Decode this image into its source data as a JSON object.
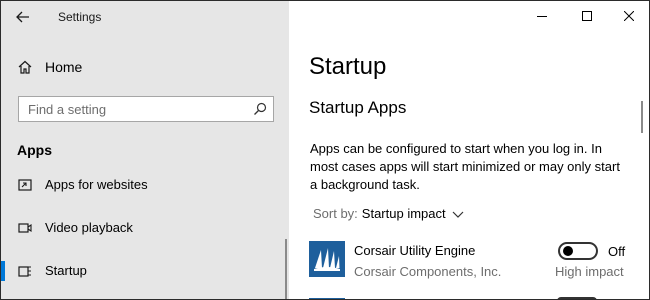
{
  "window": {
    "title": "Settings",
    "controls": {
      "minimize": "minimize-icon",
      "maximize": "maximize-icon",
      "close": "close-icon"
    }
  },
  "sidebar": {
    "home_label": "Home",
    "search_placeholder": "Find a setting",
    "section_header": "Apps",
    "items": [
      {
        "label": "Apps for websites",
        "icon": "open-in-window-icon"
      },
      {
        "label": "Video playback",
        "icon": "video-icon"
      },
      {
        "label": "Startup",
        "icon": "startup-icon",
        "selected": true
      }
    ]
  },
  "main": {
    "page_title": "Startup",
    "section_title": "Startup Apps",
    "description": "Apps can be configured to start when you log in. In most cases apps will start minimized or may only start a background task.",
    "sort": {
      "label": "Sort by:",
      "value": "Startup impact"
    },
    "apps": [
      {
        "name": "Corsair Utility Engine",
        "publisher": "Corsair Components, Inc.",
        "toggle_state": "Off",
        "impact": "High impact",
        "icon_color": "#1e5f9c"
      }
    ]
  },
  "colors": {
    "accent": "#0078d7",
    "sidebar_bg": "#e6e6e6",
    "secondary_text": "#6d6d6d"
  }
}
